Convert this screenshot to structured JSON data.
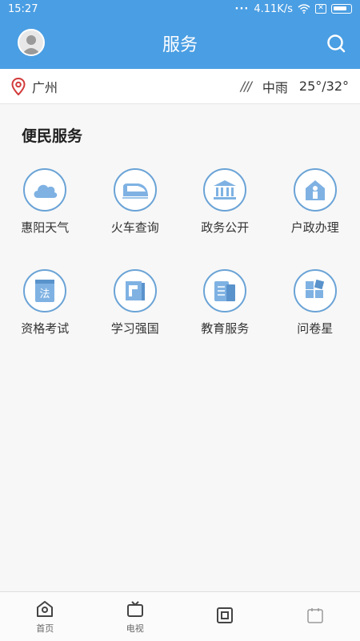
{
  "status_bar": {
    "time": "15:27",
    "network_speed": "4.11K/s"
  },
  "header": {
    "title": "服务",
    "search_icon": "search-icon",
    "avatar_icon": "avatar"
  },
  "weather": {
    "city": "广州",
    "condition": "中雨",
    "temperature": "25°/32°"
  },
  "section": {
    "title": "便民服务"
  },
  "services": [
    {
      "label": "惠阳天气",
      "icon": "cloud-icon"
    },
    {
      "label": "火车查询",
      "icon": "train-icon"
    },
    {
      "label": "政务公开",
      "icon": "government-building-icon"
    },
    {
      "label": "户政办理",
      "icon": "household-icon"
    },
    {
      "label": "资格考试",
      "icon": "law-book-icon"
    },
    {
      "label": "学习强国",
      "icon": "study-book-icon"
    },
    {
      "label": "教育服务",
      "icon": "education-icon"
    },
    {
      "label": "问卷星",
      "icon": "questionnaire-icon"
    }
  ],
  "tabbar": [
    {
      "label": "首页",
      "icon": "home-icon"
    },
    {
      "label": "电视",
      "icon": "tv-icon"
    },
    {
      "label": "",
      "icon": "media-icon"
    },
    {
      "label": "",
      "icon": "service-icon"
    }
  ],
  "colors": {
    "primary": "#4a9ee3",
    "icon_stroke": "#6aa3d6",
    "icon_fill": "#7fb2e3"
  }
}
